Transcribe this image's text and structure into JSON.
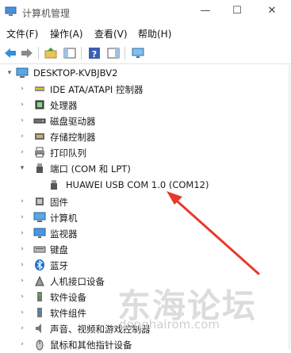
{
  "window": {
    "title": "计算机管理",
    "minimize_symbol": "—",
    "maximize_symbol": "☐",
    "close_symbol": "✕"
  },
  "menu": [
    {
      "label": "文件(F)"
    },
    {
      "label": "操作(A)"
    },
    {
      "label": "查看(V)"
    },
    {
      "label": "帮助(H)"
    }
  ],
  "toolbar": {
    "buttons": [
      {
        "icon": "back-arrow-icon"
      },
      {
        "icon": "forward-arrow-icon"
      },
      {
        "icon": "up-folder-icon"
      },
      {
        "icon": "show-hide-tree-icon"
      },
      {
        "icon": "help-icon"
      },
      {
        "icon": "action-pane-icon"
      },
      {
        "icon": "monitor-icon"
      }
    ]
  },
  "tree": {
    "root": {
      "label": "DESKTOP-KVBJBV2",
      "expanded": true,
      "icon": "computer-icon"
    },
    "items": [
      {
        "label": "IDE ATA/ATAPI 控制器",
        "icon": "ide-controller-icon",
        "expanded": false
      },
      {
        "label": "处理器",
        "icon": "processor-icon",
        "expanded": false
      },
      {
        "label": "磁盘驱动器",
        "icon": "disk-drive-icon",
        "expanded": false
      },
      {
        "label": "存储控制器",
        "icon": "storage-controller-icon",
        "expanded": false
      },
      {
        "label": "打印队列",
        "icon": "printer-icon",
        "expanded": false
      },
      {
        "label": "端口 (COM 和 LPT)",
        "icon": "port-icon",
        "expanded": true,
        "children": [
          {
            "label": "HUAWEI USB COM 1.0 (COM12)",
            "icon": "port-icon"
          }
        ]
      },
      {
        "label": "固件",
        "icon": "firmware-icon",
        "expanded": false
      },
      {
        "label": "计算机",
        "icon": "computer-icon",
        "expanded": false
      },
      {
        "label": "监视器",
        "icon": "monitor-icon",
        "expanded": false
      },
      {
        "label": "键盘",
        "icon": "keyboard-icon",
        "expanded": false
      },
      {
        "label": "蓝牙",
        "icon": "bluetooth-icon",
        "expanded": false
      },
      {
        "label": "人机接口设备",
        "icon": "hid-icon",
        "expanded": false
      },
      {
        "label": "软件设备",
        "icon": "software-device-icon",
        "expanded": false
      },
      {
        "label": "软件组件",
        "icon": "software-component-icon",
        "expanded": false
      },
      {
        "label": "声音、视频和游戏控制器",
        "icon": "speaker-icon",
        "expanded": false
      },
      {
        "label": "鼠标和其他指针设备",
        "icon": "mouse-icon",
        "expanded": false
      }
    ]
  },
  "annotation": {
    "arrow_color": "#e8392c"
  },
  "watermark": {
    "title": "东海论坛",
    "url": "donghairom.com"
  }
}
